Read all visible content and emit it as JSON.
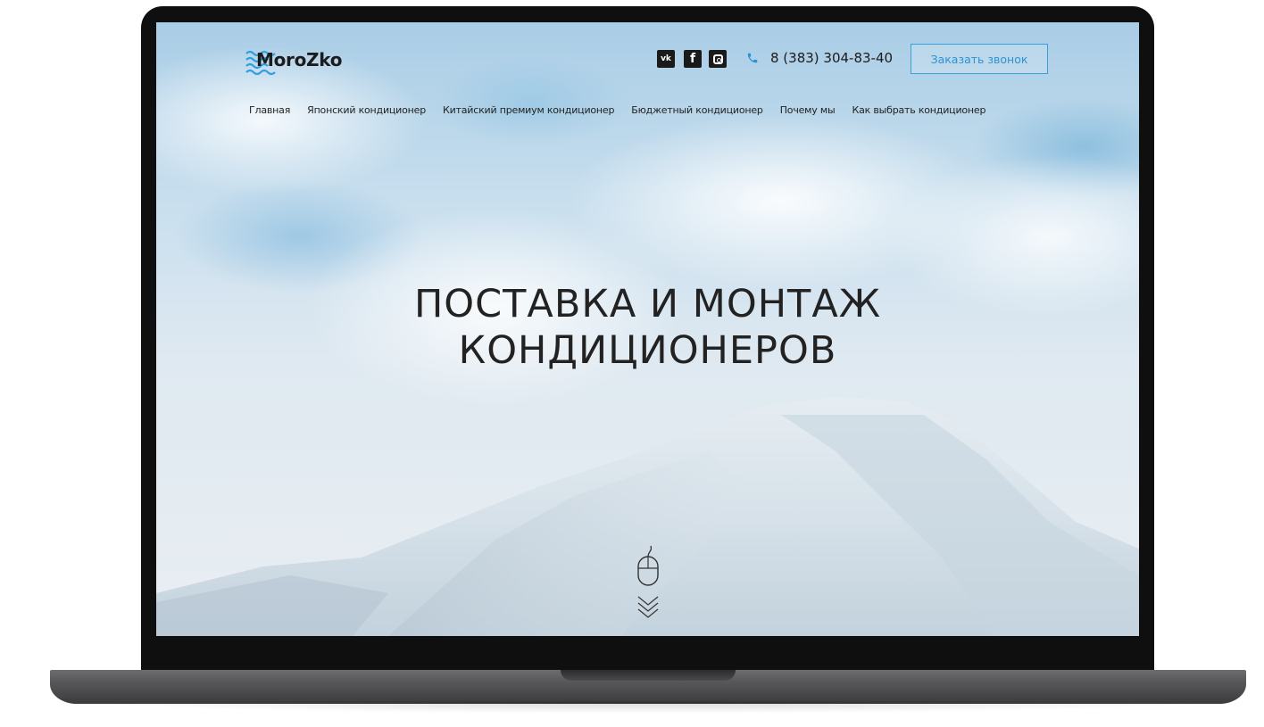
{
  "brand": {
    "logo_text": "MoroZko"
  },
  "header": {
    "social": [
      {
        "name": "vk-icon",
        "label": "vk"
      },
      {
        "name": "facebook-icon",
        "label": "f"
      },
      {
        "name": "instagram-icon",
        "label": ""
      }
    ],
    "phone": "8 (383) 304-83-40",
    "callback_label": "Заказать звонок"
  },
  "nav": {
    "items": [
      "Главная",
      "Японский кондиционер",
      "Китайский премиум кондиционер",
      "Бюджетный кондиционер",
      "Почему мы",
      "Как выбрать кондиционер"
    ]
  },
  "hero": {
    "line1": "ПОСТАВКА И МОНТАЖ",
    "line2": "КОНДИЦИОНЕРОВ"
  },
  "colors": {
    "accent": "#2b92d3",
    "logo_waves": "#2f9fe0",
    "text": "#222222"
  },
  "icons": {
    "scroll": "mouse-icon",
    "scroll_arrows": "chevrons-down-icon"
  }
}
